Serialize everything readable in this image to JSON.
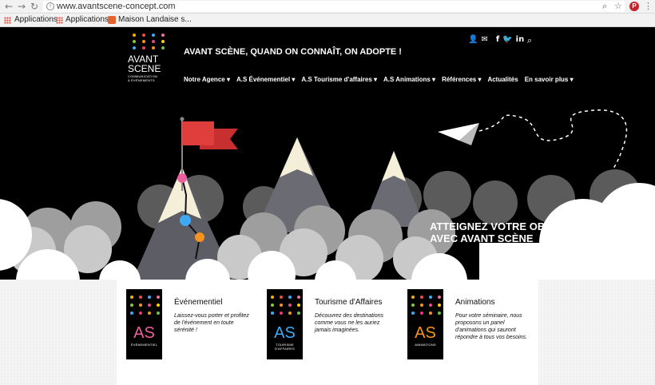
{
  "browser": {
    "url": "www.avantscene-concept.com",
    "bookmarks": [
      "Applications",
      "Applications",
      "Maison Landaise s..."
    ]
  },
  "site": {
    "logo": {
      "line1": "AVANT",
      "line2": "SCENE",
      "sub1": "COMMUNICATION",
      "sub2": "& ÉVÉNEMENTS"
    },
    "tagline": "AVANT SCÈNE, QUAND ON CONNAÎT, ON ADOPTE !",
    "nav": [
      "Notre Agence ▾",
      "A.S Événementiel ▾",
      "A.S Tourisme d'affaires ▾",
      "A.S Animations ▾",
      "Références ▾",
      "Actualités",
      "En savoir plus ▾"
    ],
    "hero_line1": "ATTEIGNEZ VOTRE OBJECTIF",
    "hero_line2": "AVEC AVANT SCÈNE"
  },
  "colors": {
    "dots": [
      "#f2b400",
      "#e8504a",
      "#3fa9f5",
      "#ee6fa3",
      "#8dc63f",
      "#f7941d",
      "#e14b8a",
      "#ffd200",
      "#3fa9f5",
      "#ec3d6c",
      "#f7941d",
      "#6cc24a"
    ],
    "evenementiel": "#ec5f9f",
    "tourisme": "#3fa9f5",
    "animations": "#f7941d"
  },
  "cards": [
    {
      "title": "Événementiel",
      "badge": "AS",
      "badge_sub1": "ÉVÉNEMENTIEL",
      "badge_sub2": "",
      "desc": "Laissez-vous porter et profitez de l'événement en toute sérénité !"
    },
    {
      "title": "Tourisme d'Affaires",
      "badge": "AS",
      "badge_sub1": "TOURISME",
      "badge_sub2": "D'AFFAIRES",
      "desc": "Découvrez des destinations comme vous ne les auriez jamais imaginées."
    },
    {
      "title": "Animations",
      "badge": "AS",
      "badge_sub1": "ANIMATIONS",
      "badge_sub2": "",
      "desc": "Pour votre séminaire, nous proposons un panel d'animations qui sauront répondre à tous vos besoins."
    }
  ]
}
